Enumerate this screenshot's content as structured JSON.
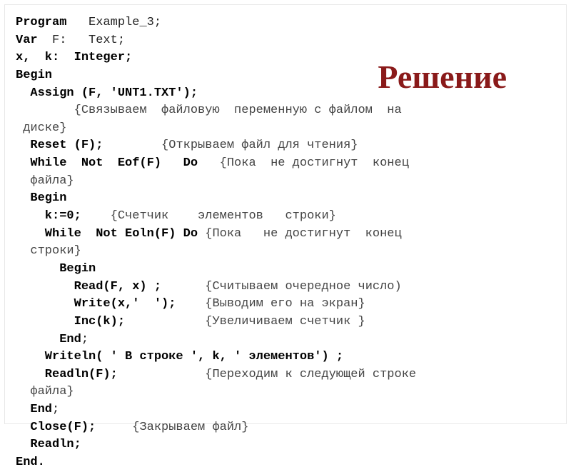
{
  "title": "Решение",
  "code": {
    "l01a": "Program",
    "l01b": "   Example_3;",
    "l02a": "Var",
    "l02b": "  F:   Text;",
    "l03a": "x,  k:  Integer;",
    "l04a": "Begin",
    "l05a": "  Assign (F, 'UNT1.TXT');",
    "l06a": "        {Связываем  файловую  переменную с файлом  на",
    "l07a": " диске}",
    "l08a": "  Reset (F);",
    "l08b": "        {Открываем файл для чтения}",
    "l09a": "  While  Not  Eof(F)   Do",
    "l09b": "   {Пока  не достигнут  конец",
    "l10a": "  файла}",
    "l11a": "  Begin",
    "l12a": "    k:=0;",
    "l12b": "    {Счетчик    элементов   строки}",
    "l13a": "    While  Not Eoln(F) Do",
    "l13b": " {Пока   не достигнут  конец",
    "l14a": "  строки}",
    "l15a": "      Begin",
    "l16a": "        Read(F, x) ;",
    "l16b": "      {Считываем очередное число)",
    "l17a": "        Write(x,'  ');",
    "l17b": "    {Выводим его на экран}",
    "l18a": "        Inc(k);",
    "l18b": "           {Увеличиваем счетчик }",
    "l19a": "      End",
    "l19b": ";",
    "l20a": "    Writeln( ' В строке ', k, ' элементов') ;",
    "l21a": "    Readln(F);",
    "l21b": "            {Переходим к следующей строке",
    "l22a": "  файла}",
    "l23a": "  End",
    "l23b": ";",
    "l24a": "  Close(F);",
    "l24b": "     {Закрываем файл}",
    "l25a": "  Readln;",
    "l26a": "End."
  }
}
